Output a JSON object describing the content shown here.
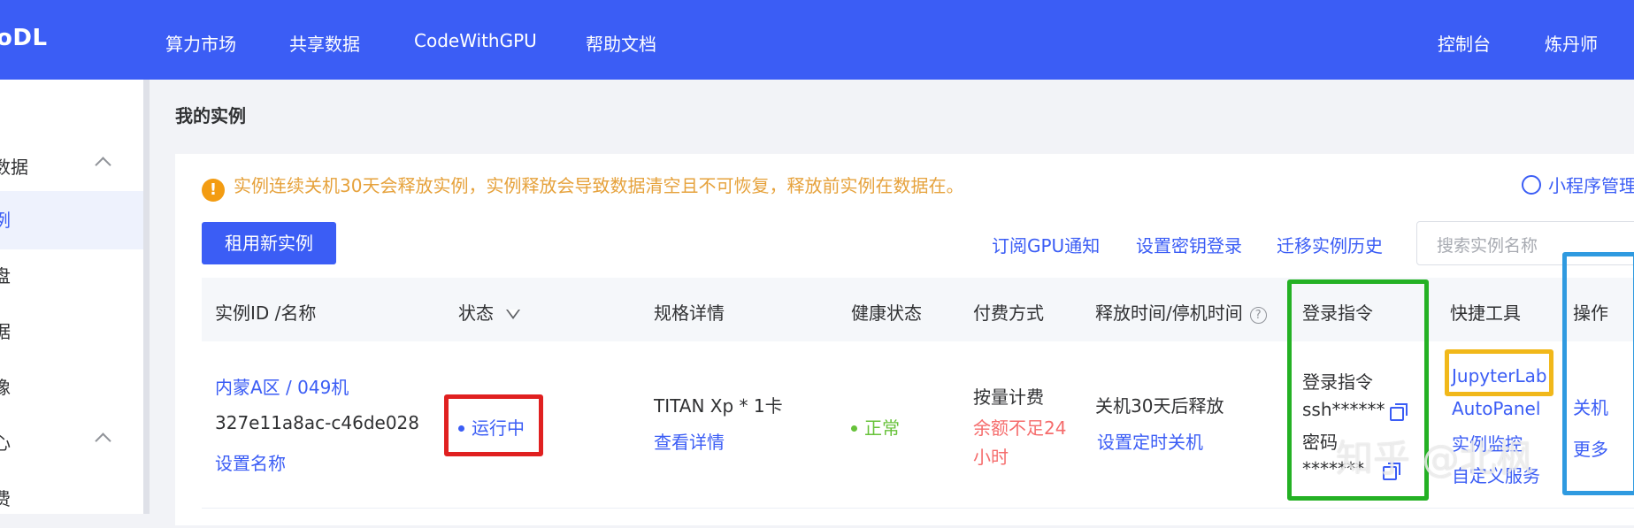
{
  "topnav": {
    "logo": "oDL",
    "items": [
      "算力市场",
      "共享数据",
      "CodeWithGPU",
      "帮助文档"
    ],
    "right_items": [
      "控制台",
      "炼丹师"
    ]
  },
  "sidebar": {
    "items": [
      {
        "label": "数据",
        "expanded": true
      },
      {
        "label": "例",
        "active": true
      },
      {
        "label": "盘"
      },
      {
        "label": "据"
      },
      {
        "label": "像"
      },
      {
        "label": "心",
        "expanded": true
      },
      {
        "label": "费"
      }
    ]
  },
  "page": {
    "title": "我的实例",
    "warning": "实例连续关机30天会释放实例，实例释放会导致数据清空且不可恢复，释放前实例在数据在。",
    "mini_program": "小程序管理",
    "new_instance_button": "租用新实例",
    "links": [
      "订阅GPU通知",
      "设置密钥登录",
      "迁移实例历史"
    ],
    "search_placeholder": "搜索实例名称"
  },
  "table": {
    "headers": [
      "实例ID /名称",
      "状态",
      "规格详情",
      "健康状态",
      "付费方式",
      "释放时间/停机时间",
      "登录指令",
      "快捷工具",
      "操作"
    ],
    "row": {
      "region": "内蒙A区 / 049机",
      "instance_id": "327e11a8ac-c46de028",
      "set_name": "设置名称",
      "status": "运行中",
      "spec": "TITAN Xp * 1卡",
      "spec_detail_link": "查看详情",
      "health": "正常",
      "billing": "按量计费",
      "balance_warning_line1": "余额不足24",
      "balance_warning_line2": "小时",
      "release": "关机30天后释放",
      "set_timer": "设置定时关机",
      "login_label": "登录指令",
      "ssh": "ssh******",
      "password_label": "密码",
      "password_value": "*******",
      "tools": [
        "JupyterLab",
        "AutoPanel",
        "实例监控",
        "自定义服务"
      ],
      "actions": [
        "关机",
        "更多"
      ]
    }
  },
  "watermark": "知乎 @北枫",
  "colors": {
    "brand": "#3b5df5",
    "warning": "#e6a23c",
    "success": "#67c23a",
    "danger": "#f56c6c",
    "highlight_red": "#e02020",
    "highlight_green": "#24b124",
    "highlight_yellow": "#f1b81a",
    "highlight_blue": "#2f9ae0"
  }
}
